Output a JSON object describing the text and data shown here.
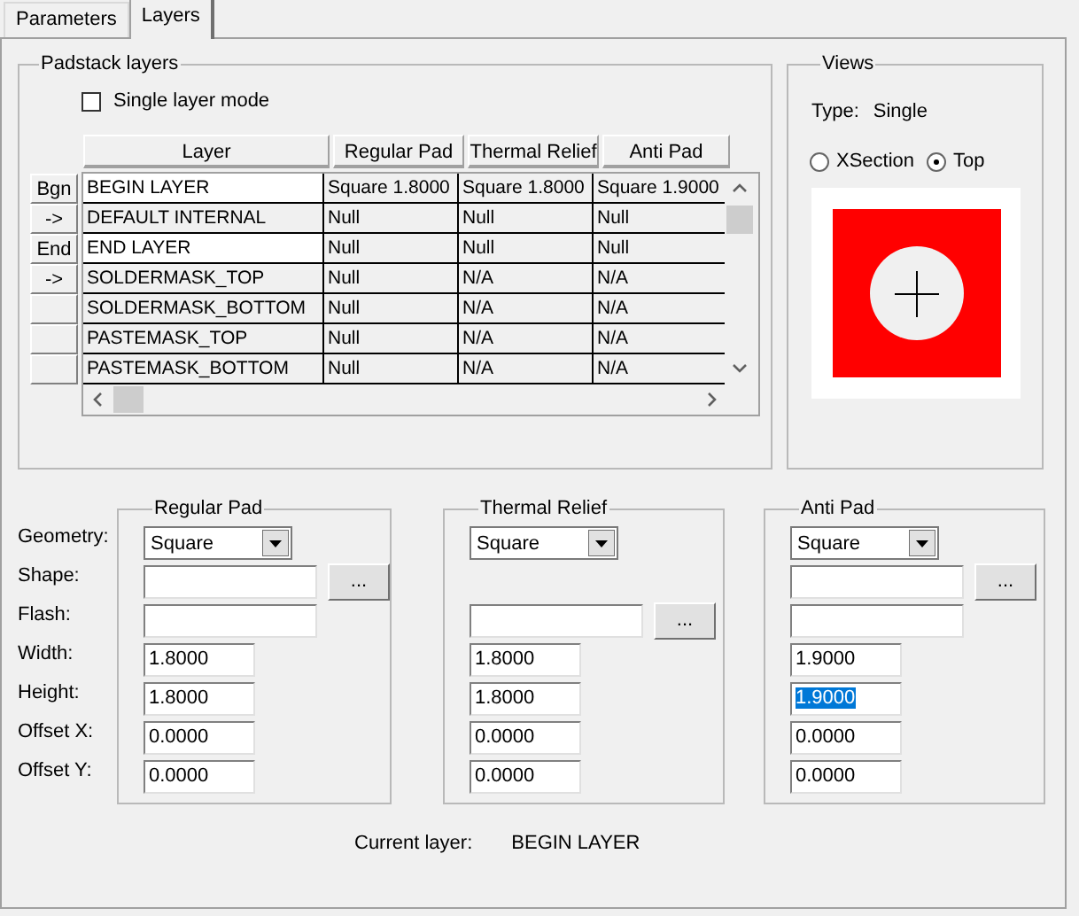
{
  "tabs": [
    {
      "label": "Parameters",
      "selected": false
    },
    {
      "label": "Layers",
      "selected": true
    }
  ],
  "padstack_layers": {
    "title": "Padstack layers",
    "single_layer_mode": {
      "label": "Single layer mode",
      "checked": false
    },
    "columns": [
      "Layer",
      "Regular Pad",
      "Thermal Relief",
      "Anti Pad"
    ],
    "rows": [
      {
        "marker": "Bgn",
        "highlighted": true,
        "cells": [
          "BEGIN LAYER",
          "Square 1.8000",
          "Square 1.8000",
          "Square 1.9000"
        ]
      },
      {
        "marker": "->",
        "highlighted": false,
        "cells": [
          "DEFAULT INTERNAL",
          "Null",
          "Null",
          "Null"
        ]
      },
      {
        "marker": "End",
        "highlighted": true,
        "cells": [
          "END LAYER",
          "Null",
          "Null",
          "Null"
        ]
      },
      {
        "marker": "->",
        "highlighted": false,
        "cells": [
          "SOLDERMASK_TOP",
          "Null",
          "N/A",
          "N/A"
        ]
      },
      {
        "highlighted": false,
        "cells": [
          "SOLDERMASK_BOTTOM",
          "Null",
          "N/A",
          "N/A"
        ]
      },
      {
        "highlighted": false,
        "cells": [
          "PASTEMASK_TOP",
          "Null",
          "N/A",
          "N/A"
        ]
      },
      {
        "highlighted": false,
        "cells": [
          "PASTEMASK_BOTTOM",
          "Null",
          "N/A",
          "N/A"
        ]
      }
    ]
  },
  "views": {
    "title": "Views",
    "type_label": "Type:",
    "type_value": "Single",
    "options": [
      {
        "label": "XSection",
        "selected": false
      },
      {
        "label": "Top",
        "selected": true
      }
    ]
  },
  "pad_groups": {
    "row_labels": [
      "Geometry:",
      "Shape:",
      "Flash:",
      "Width:",
      "Height:",
      "Offset X:",
      "Offset Y:"
    ],
    "groups": [
      {
        "title": "Regular Pad",
        "rows": [
          {
            "kind": "dropdown",
            "value": "Square"
          },
          {
            "kind": "field_browse",
            "button": "..."
          },
          {
            "kind": "field"
          },
          {
            "kind": "number",
            "value": "1.8000",
            "selected": false
          },
          {
            "kind": "number",
            "value": "1.8000",
            "selected": false
          },
          {
            "kind": "number",
            "value": "0.0000",
            "selected": false
          },
          {
            "kind": "number",
            "value": "0.0000",
            "selected": false
          }
        ]
      },
      {
        "title": "Thermal Relief",
        "rows": [
          {
            "kind": "dropdown",
            "value": "Square"
          },
          {
            "kind": "none"
          },
          {
            "kind": "field_browse",
            "button": "..."
          },
          {
            "kind": "number",
            "value": "1.8000",
            "selected": false
          },
          {
            "kind": "number",
            "value": "1.8000",
            "selected": false
          },
          {
            "kind": "number",
            "value": "0.0000",
            "selected": false
          },
          {
            "kind": "number",
            "value": "0.0000",
            "selected": false
          }
        ]
      },
      {
        "title": "Anti Pad",
        "rows": [
          {
            "kind": "dropdown",
            "value": "Square"
          },
          {
            "kind": "field_browse",
            "button": "..."
          },
          {
            "kind": "field"
          },
          {
            "kind": "number",
            "value": "1.9000",
            "selected": false
          },
          {
            "kind": "number",
            "value": "1.9000",
            "selected": true
          },
          {
            "kind": "number",
            "value": "0.0000",
            "selected": false
          },
          {
            "kind": "number",
            "value": "0.0000",
            "selected": false
          }
        ]
      }
    ]
  },
  "current_layer": {
    "label": "Current layer:",
    "value": "BEGIN LAYER"
  }
}
